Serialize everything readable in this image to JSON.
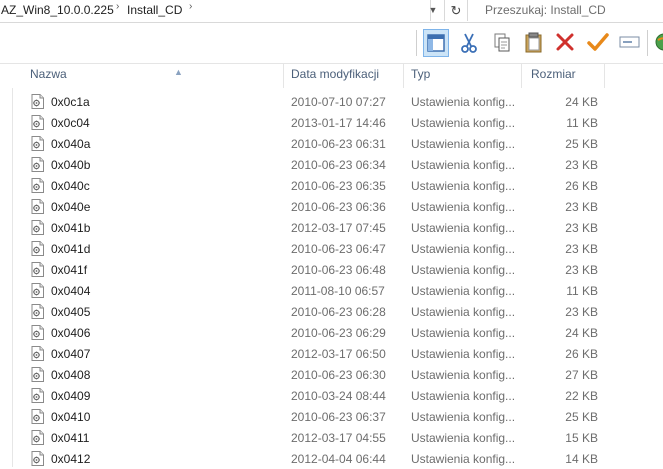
{
  "address": {
    "crumbs": [
      "AZ_Win8_10.0.0.225",
      "Install_CD"
    ],
    "separator": "›",
    "dropdown_icon": "chevron-down-icon",
    "refresh_icon": "refresh-icon"
  },
  "search": {
    "placeholder": "Przeszukaj: Install_CD"
  },
  "toolbar": {
    "buttons": [
      "layout-pane-icon",
      "cut-icon",
      "copy-icon",
      "paste-icon",
      "delete-icon",
      "checkmark-icon",
      "rename-icon",
      "globe-icon"
    ]
  },
  "columns": {
    "name": "Nazwa",
    "date": "Data modyfikacji",
    "type": "Typ",
    "size": "Rozmiar"
  },
  "files": [
    {
      "name": "0x0c1a",
      "date": "2010-07-10 07:27",
      "type": "Ustawienia konfig...",
      "size": "24 KB"
    },
    {
      "name": "0x0c04",
      "date": "2013-01-17 14:46",
      "type": "Ustawienia konfig...",
      "size": "11 KB"
    },
    {
      "name": "0x040a",
      "date": "2010-06-23 06:31",
      "type": "Ustawienia konfig...",
      "size": "25 KB"
    },
    {
      "name": "0x040b",
      "date": "2010-06-23 06:34",
      "type": "Ustawienia konfig...",
      "size": "23 KB"
    },
    {
      "name": "0x040c",
      "date": "2010-06-23 06:35",
      "type": "Ustawienia konfig...",
      "size": "26 KB"
    },
    {
      "name": "0x040e",
      "date": "2010-06-23 06:36",
      "type": "Ustawienia konfig...",
      "size": "23 KB"
    },
    {
      "name": "0x041b",
      "date": "2012-03-17 07:45",
      "type": "Ustawienia konfig...",
      "size": "23 KB"
    },
    {
      "name": "0x041d",
      "date": "2010-06-23 06:47",
      "type": "Ustawienia konfig...",
      "size": "23 KB"
    },
    {
      "name": "0x041f",
      "date": "2010-06-23 06:48",
      "type": "Ustawienia konfig...",
      "size": "23 KB"
    },
    {
      "name": "0x0404",
      "date": "2011-08-10 06:57",
      "type": "Ustawienia konfig...",
      "size": "11 KB"
    },
    {
      "name": "0x0405",
      "date": "2010-06-23 06:28",
      "type": "Ustawienia konfig...",
      "size": "23 KB"
    },
    {
      "name": "0x0406",
      "date": "2010-06-23 06:29",
      "type": "Ustawienia konfig...",
      "size": "24 KB"
    },
    {
      "name": "0x0407",
      "date": "2012-03-17 06:50",
      "type": "Ustawienia konfig...",
      "size": "26 KB"
    },
    {
      "name": "0x0408",
      "date": "2010-06-23 06:30",
      "type": "Ustawienia konfig...",
      "size": "27 KB"
    },
    {
      "name": "0x0409",
      "date": "2010-03-24 08:44",
      "type": "Ustawienia konfig...",
      "size": "22 KB"
    },
    {
      "name": "0x0410",
      "date": "2010-06-23 06:37",
      "type": "Ustawienia konfig...",
      "size": "25 KB"
    },
    {
      "name": "0x0411",
      "date": "2012-03-17 04:55",
      "type": "Ustawienia konfig...",
      "size": "15 KB"
    },
    {
      "name": "0x0412",
      "date": "2012-04-04 06:44",
      "type": "Ustawienia konfig...",
      "size": "14 KB"
    }
  ]
}
